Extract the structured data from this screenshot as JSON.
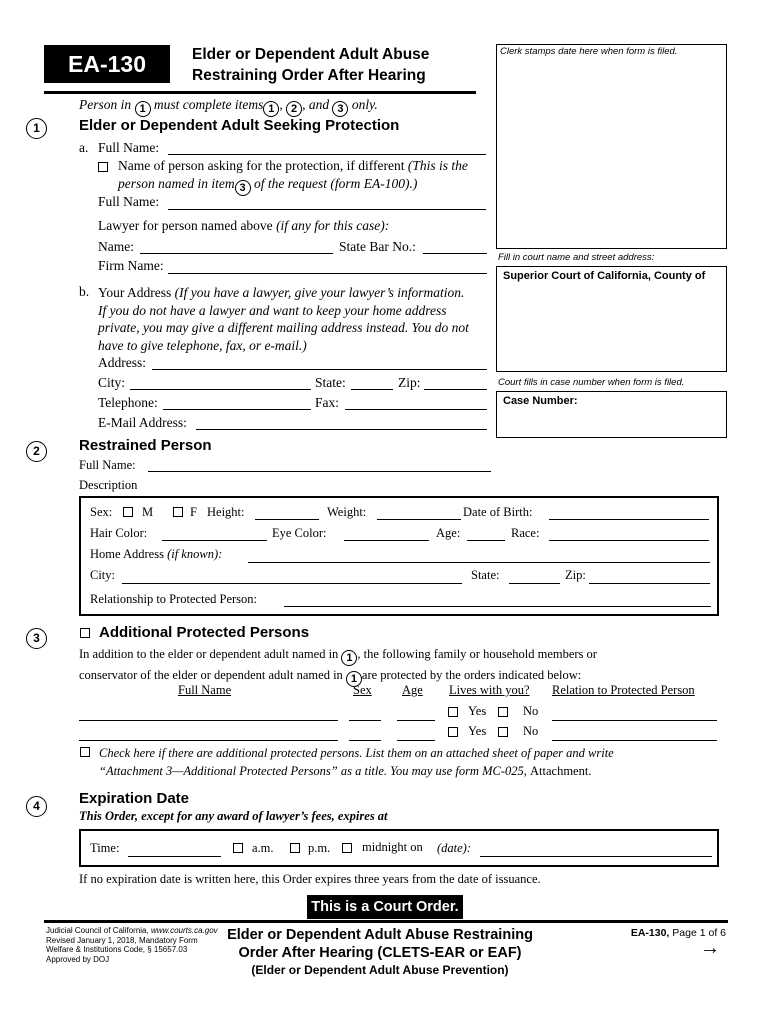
{
  "header": {
    "form_id": "EA-130",
    "title_line1": "Elder or Dependent Adult Abuse",
    "title_line2": "Restraining Order After Hearing",
    "clerk_stamp_note": "Clerk stamps date here when form is filed.",
    "court_note": "Fill in court name and street address:",
    "court_label": "Superior Court of California, County of",
    "case_note": "Court fills in case number when form is filed.",
    "case_label": "Case Number:"
  },
  "instructions": {
    "prefix": "Person in",
    "mid": "must complete items",
    "sep1": ",",
    "sep2": ", and",
    "suffix": "only.",
    "n1": "1",
    "n2": "1",
    "n3": "2",
    "n4": "3"
  },
  "section1": {
    "number": "1",
    "title": "Elder or Dependent Adult Seeking Protection",
    "a_label": "a.",
    "full_name_label": "Full Name:",
    "full_name_value": "",
    "diff_checkbox_label": "Name of person asking for the protection, if different",
    "diff_note_1": "(This is the",
    "diff_note_2a": "person named in item",
    "diff_note_item": "3",
    "diff_note_2b": "of the request (form EA-100).)",
    "full_name2_label": "Full Name:",
    "full_name2_value": "",
    "lawyer_label": "Lawyer for person named above",
    "lawyer_note": "(if any for this case):",
    "name_label": "Name:",
    "name_value": "",
    "bar_label": "State Bar No.:",
    "bar_value": "",
    "firm_label": "Firm Name:",
    "firm_value": "",
    "b_label": "b.",
    "address_title": "Your Address",
    "address_note_1": "(If you have a lawyer, give your lawyer’s information.",
    "address_note_2": "If you do not have a lawyer and want to keep your home address",
    "address_note_3": "private, you may give a different mailing address instead. You do not",
    "address_note_4": "have to give telephone, fax, or e-mail.)",
    "address_label": "Address:",
    "address_value": "",
    "city_label": "City:",
    "city_value": "",
    "state_label": "State:",
    "state_value": "",
    "zip_label": "Zip:",
    "zip_value": "",
    "phone_label": "Telephone:",
    "phone_value": "",
    "fax_label": "Fax:",
    "fax_value": "",
    "email_label": "E-Mail Address:",
    "email_value": ""
  },
  "section2": {
    "number": "2",
    "title": "Restrained Person",
    "full_name_label": "Full Name:",
    "full_name_value": "",
    "description_label": "Description",
    "sex_label": "Sex:",
    "sex_m": "M",
    "sex_f": "F",
    "height_label": "Height:",
    "weight_label": "Weight:",
    "dob_label": "Date of Birth:",
    "hair_label": "Hair Color:",
    "eye_label": "Eye Color:",
    "age_label": "Age:",
    "race_label": "Race:",
    "home_label": "Home Address",
    "home_note": "(if known):",
    "city_label": "City:",
    "state_label": "State:",
    "zip_label": "Zip:",
    "relationship_label": "Relationship to Protected Person:"
  },
  "section3": {
    "number": "3",
    "title": "Additional Protected Persons",
    "intro_1a": "In addition to the elder or dependent adult named in",
    "intro_1b": ", the following family or household members or",
    "intro_2a": "conservator of the elder or dependent adult named in",
    "intro_2b": "are protected by the orders indicated below:",
    "ref": "1",
    "columns": [
      "Full Name",
      "Sex",
      "Age",
      "Lives with you?",
      "Relation to Protected Person"
    ],
    "yes_label": "Yes",
    "no_label": "No",
    "rows": [
      {
        "full_name": "",
        "sex": "",
        "age": "",
        "relation": ""
      },
      {
        "full_name": "",
        "sex": "",
        "age": "",
        "relation": ""
      }
    ],
    "more_line1": "Check here if there are additional protected persons. List them on an attached sheet of paper and write",
    "more_line2a": "“Attachment 3—Additional Protected Persons” as a title. You may use form MC-025,",
    "more_line2b": "Attachment."
  },
  "section4": {
    "number": "4",
    "title": "Expiration Date",
    "subtitle": "This Order, except for any award of lawyer’s fees, expires at",
    "time_label": "Time:",
    "am_label": "a.m.",
    "pm_label": "p.m.",
    "midnight_label": "midnight on",
    "date_label": "(date):",
    "note": "If no expiration date is written here, this Order expires three years from the date of issuance."
  },
  "court_order_banner": "This is a Court Order.",
  "footer": {
    "left_1a": "Judicial Council of California,",
    "left_1b": "www.courts.ca.gov",
    "left_2": "Revised January 1, 2018, Mandatory Form",
    "left_3": "Welfare & Institutions Code, § 15657.03",
    "left_4": "Approved by DOJ",
    "center_1": "Elder or Dependent Adult Abuse Restraining",
    "center_2": "Order After Hearing (CLETS-EAR or EAF)",
    "center_3": "(Elder or Dependent Adult Abuse Prevention)",
    "form_id": "EA-130,",
    "page": "Page 1 of 6",
    "next_icon": "→"
  }
}
